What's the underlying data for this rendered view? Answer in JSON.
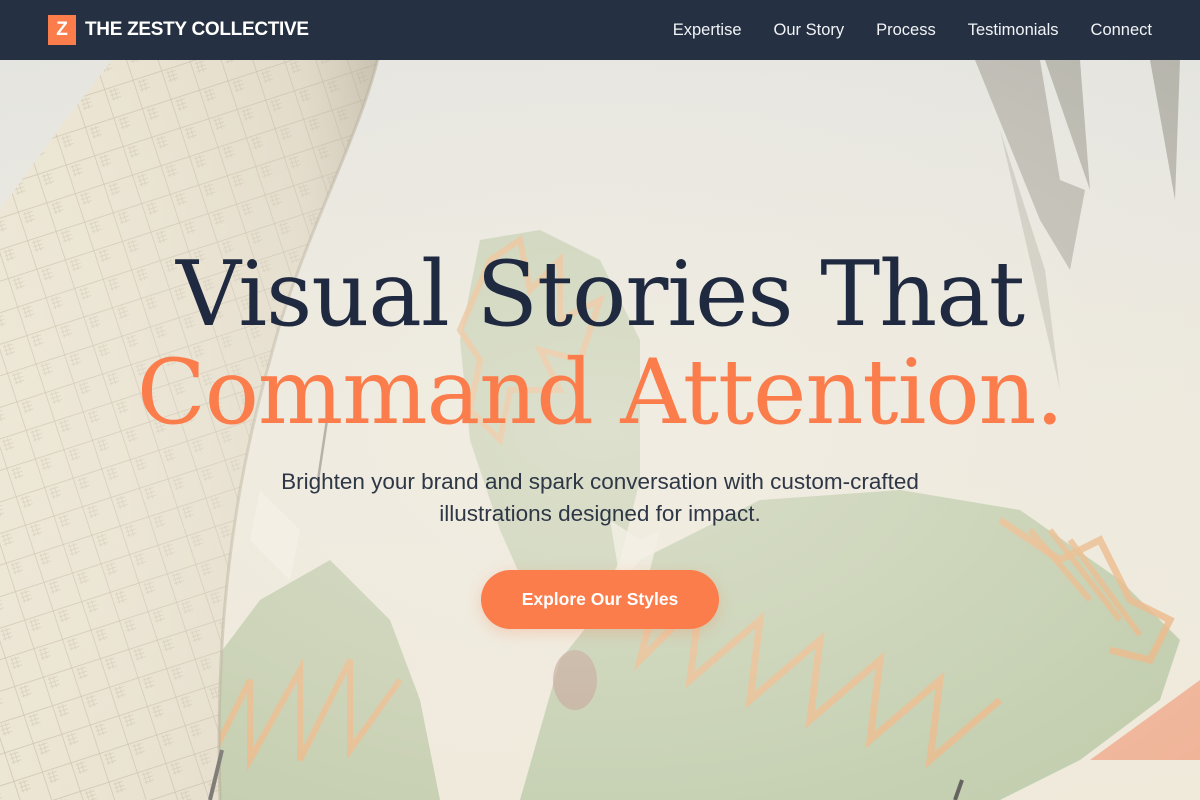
{
  "nav": {
    "brand_letter": "Z",
    "brand_name": "THE ZESTY COLLECTIVE",
    "links": [
      {
        "label": "Expertise"
      },
      {
        "label": "Our Story"
      },
      {
        "label": "Process"
      },
      {
        "label": "Testimonials"
      },
      {
        "label": "Connect"
      }
    ]
  },
  "hero": {
    "headline_line1": "Visual Stories That",
    "headline_line2": "Command Attention.",
    "subtitle": "Brighten your brand and spark conversation with custom-crafted illustrations designed for impact.",
    "cta_label": "Explore Our Styles"
  },
  "colors": {
    "nav_background": "#253142",
    "accent": "#fb7d4c",
    "headline_dark": "#1f2940",
    "body_text": "#2e3746"
  }
}
